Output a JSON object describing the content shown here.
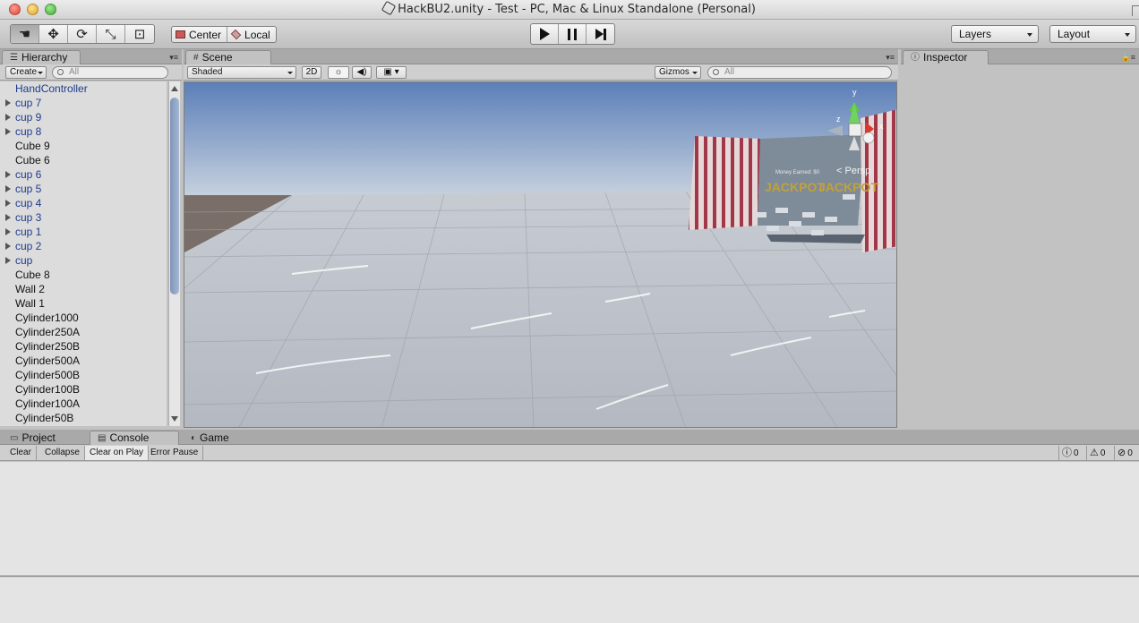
{
  "window": {
    "title": "HackBU2.unity - Test - PC, Mac & Linux Standalone (Personal)"
  },
  "toolbar": {
    "tools": [
      {
        "icon": "hand-icon",
        "glyph": "☚"
      },
      {
        "icon": "move-icon",
        "glyph": "✥"
      },
      {
        "icon": "rotate-icon",
        "glyph": "⟳"
      },
      {
        "icon": "scale-icon",
        "glyph": "⤡"
      },
      {
        "icon": "rect-tool-icon",
        "glyph": "⊡"
      }
    ],
    "pivot_label": "Center",
    "space_label": "Local",
    "layers_label": "Layers",
    "layout_label": "Layout"
  },
  "hierarchy": {
    "tab_label": "Hierarchy",
    "create_label": "Create",
    "search_placeholder": "All",
    "items": [
      {
        "label": "HandController",
        "prefab": true,
        "expandable": false
      },
      {
        "label": "cup 7",
        "prefab": true,
        "expandable": true
      },
      {
        "label": "cup 9",
        "prefab": true,
        "expandable": true
      },
      {
        "label": "cup 8",
        "prefab": true,
        "expandable": true
      },
      {
        "label": "Cube 9",
        "prefab": false,
        "expandable": false
      },
      {
        "label": "Cube 6",
        "prefab": false,
        "expandable": false
      },
      {
        "label": "cup 6",
        "prefab": true,
        "expandable": true
      },
      {
        "label": "cup 5",
        "prefab": true,
        "expandable": true
      },
      {
        "label": "cup 4",
        "prefab": true,
        "expandable": true
      },
      {
        "label": "cup 3",
        "prefab": true,
        "expandable": true
      },
      {
        "label": "cup 1",
        "prefab": true,
        "expandable": true
      },
      {
        "label": "cup 2",
        "prefab": true,
        "expandable": true
      },
      {
        "label": "cup",
        "prefab": true,
        "expandable": true
      },
      {
        "label": "Cube 8",
        "prefab": false,
        "expandable": false
      },
      {
        "label": "Wall 2",
        "prefab": false,
        "expandable": false
      },
      {
        "label": "Wall 1",
        "prefab": false,
        "expandable": false
      },
      {
        "label": "Cylinder1000",
        "prefab": false,
        "expandable": false
      },
      {
        "label": "Cylinder250A",
        "prefab": false,
        "expandable": false
      },
      {
        "label": "Cylinder250B",
        "prefab": false,
        "expandable": false
      },
      {
        "label": "Cylinder500A",
        "prefab": false,
        "expandable": false
      },
      {
        "label": "Cylinder500B",
        "prefab": false,
        "expandable": false
      },
      {
        "label": "Cylinder100B",
        "prefab": false,
        "expandable": false
      },
      {
        "label": "Cylinder100A",
        "prefab": false,
        "expandable": false
      },
      {
        "label": "Cylinder50B",
        "prefab": false,
        "expandable": false
      }
    ]
  },
  "scene": {
    "tab_label": "Scene",
    "shading_label": "Shaded",
    "mode_2d_label": "2D",
    "gizmos_label": "Gizmos",
    "search_placeholder": "All",
    "persp_label": "Persp",
    "gizmo_axes": {
      "y": "y",
      "x": "x",
      "z": "z"
    },
    "booth_text_score": "Money Earned: $0",
    "booth_text_banner": "JACKPOT",
    "colors": {
      "sky_top": "#5b7fb8",
      "sky_bottom": "#c9d3e0",
      "floor": "#b9bec6"
    }
  },
  "inspector": {
    "tab_label": "Inspector"
  },
  "bottom": {
    "tabs": [
      {
        "label": "Project",
        "icon": "folder-icon",
        "glyph": "▭"
      },
      {
        "label": "Console",
        "icon": "console-icon",
        "glyph": "▤"
      },
      {
        "label": "Game",
        "icon": "game-icon",
        "glyph": "◐"
      }
    ],
    "console_buttons": [
      "Clear",
      "Collapse",
      "Clear on Play",
      "Error Pause"
    ],
    "counts": {
      "info": "0",
      "warning": "0",
      "error": "0"
    }
  }
}
